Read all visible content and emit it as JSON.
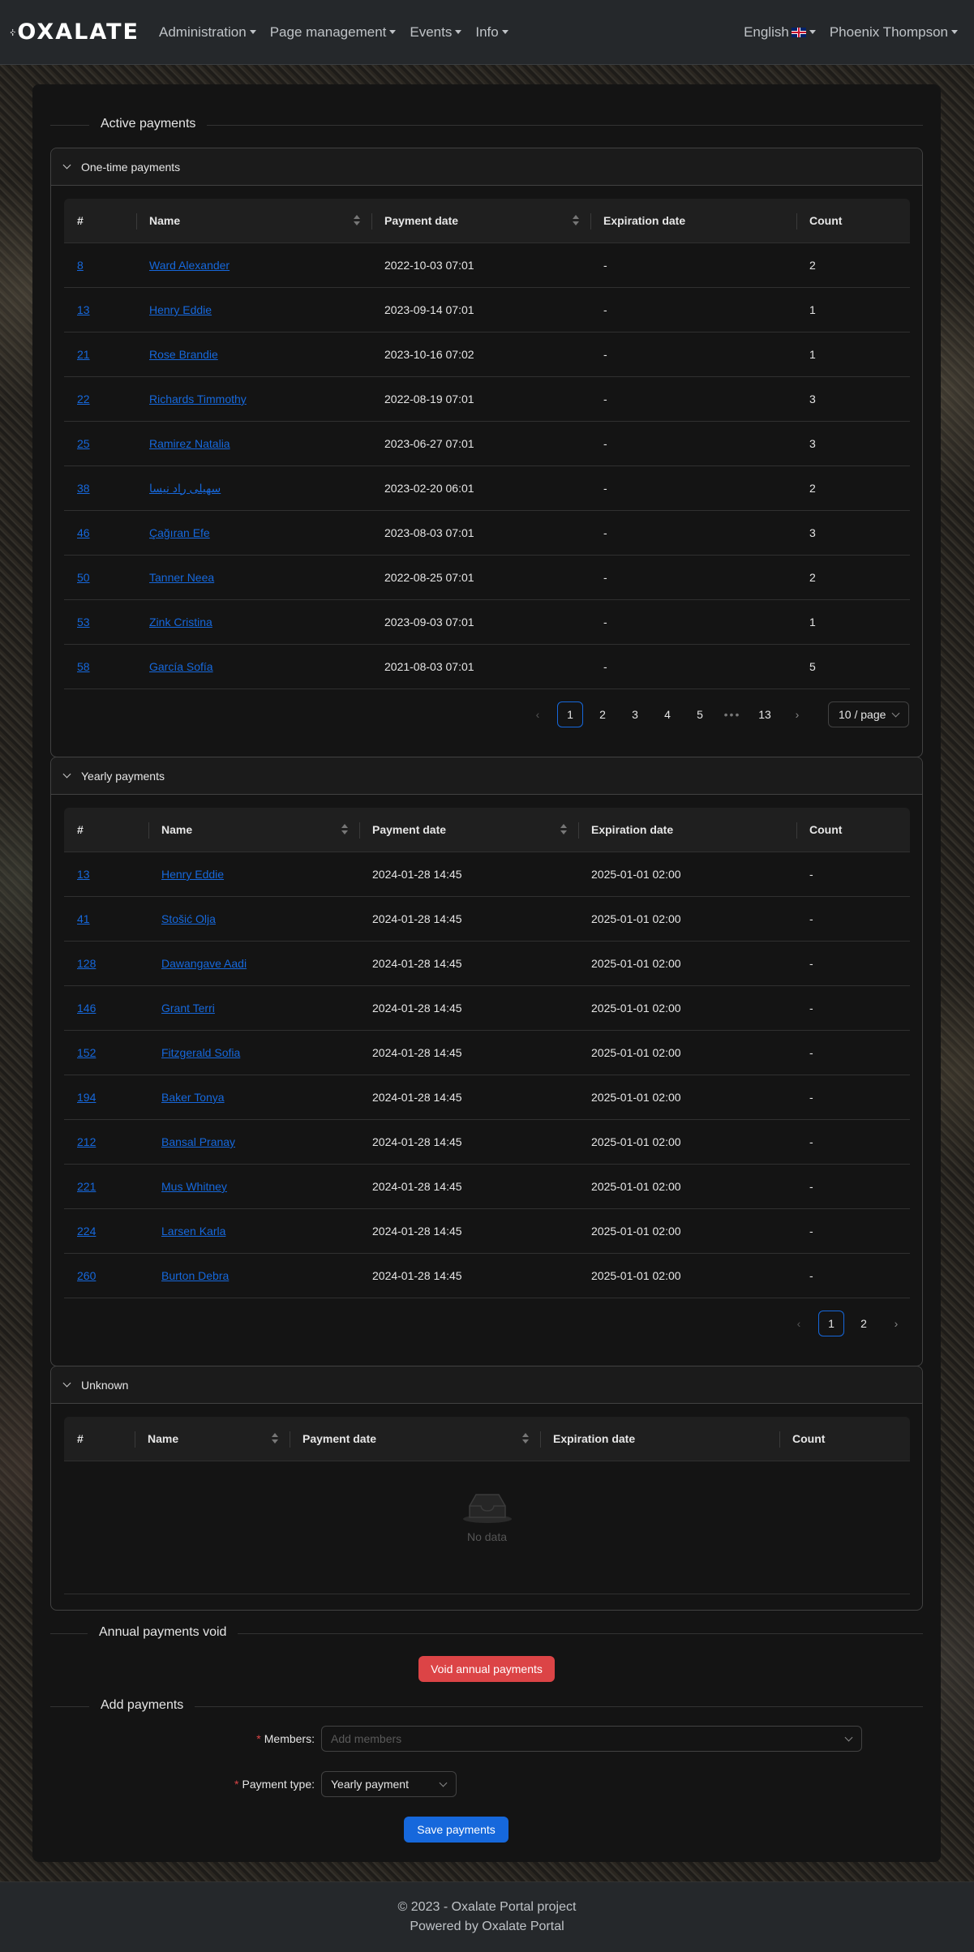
{
  "navbar": {
    "logo_text": "OXALATE",
    "menu": [
      {
        "label": "Administration"
      },
      {
        "label": "Page management"
      },
      {
        "label": "Events"
      },
      {
        "label": "Info"
      }
    ],
    "language": "English",
    "user": "Phoenix Thompson"
  },
  "active_payments": {
    "title": "Active payments",
    "columns": [
      "#",
      "Name",
      "Payment date",
      "Expiration date",
      "Count"
    ],
    "one_time": {
      "title": "One-time payments",
      "rows": [
        {
          "id": "8",
          "name": "Ward Alexander",
          "payment_date": "2022-10-03 07:01",
          "expiration": "-",
          "count": "2"
        },
        {
          "id": "13",
          "name": "Henry Eddie",
          "payment_date": "2023-09-14 07:01",
          "expiration": "-",
          "count": "1"
        },
        {
          "id": "21",
          "name": "Rose Brandie",
          "payment_date": "2023-10-16 07:02",
          "expiration": "-",
          "count": "1"
        },
        {
          "id": "22",
          "name": "Richards Timmothy",
          "payment_date": "2022-08-19 07:01",
          "expiration": "-",
          "count": "3"
        },
        {
          "id": "25",
          "name": "Ramirez Natalia",
          "payment_date": "2023-06-27 07:01",
          "expiration": "-",
          "count": "3"
        },
        {
          "id": "38",
          "name": "سهیلی راد نیسا",
          "payment_date": "2023-02-20 06:01",
          "expiration": "-",
          "count": "2"
        },
        {
          "id": "46",
          "name": "Çağıran Efe",
          "payment_date": "2023-08-03 07:01",
          "expiration": "-",
          "count": "3"
        },
        {
          "id": "50",
          "name": "Tanner Neea",
          "payment_date": "2022-08-25 07:01",
          "expiration": "-",
          "count": "2"
        },
        {
          "id": "53",
          "name": "Zink Cristina",
          "payment_date": "2023-09-03 07:01",
          "expiration": "-",
          "count": "1"
        },
        {
          "id": "58",
          "name": "García Sofía",
          "payment_date": "2021-08-03 07:01",
          "expiration": "-",
          "count": "5"
        }
      ],
      "pagination": {
        "pages": [
          "1",
          "2",
          "3",
          "4",
          "5"
        ],
        "ellipsis": "•••",
        "last": "13",
        "page_size": "10 / page"
      }
    },
    "yearly": {
      "title": "Yearly payments",
      "rows": [
        {
          "id": "13",
          "name": "Henry Eddie",
          "payment_date": "2024-01-28 14:45",
          "expiration": "2025-01-01 02:00",
          "count": "-"
        },
        {
          "id": "41",
          "name": "Stošić Olja",
          "payment_date": "2024-01-28 14:45",
          "expiration": "2025-01-01 02:00",
          "count": "-"
        },
        {
          "id": "128",
          "name": "Dawangave Aadi",
          "payment_date": "2024-01-28 14:45",
          "expiration": "2025-01-01 02:00",
          "count": "-"
        },
        {
          "id": "146",
          "name": "Grant Terri",
          "payment_date": "2024-01-28 14:45",
          "expiration": "2025-01-01 02:00",
          "count": "-"
        },
        {
          "id": "152",
          "name": "Fitzgerald Sofia",
          "payment_date": "2024-01-28 14:45",
          "expiration": "2025-01-01 02:00",
          "count": "-"
        },
        {
          "id": "194",
          "name": "Baker Tonya",
          "payment_date": "2024-01-28 14:45",
          "expiration": "2025-01-01 02:00",
          "count": "-"
        },
        {
          "id": "212",
          "name": "Bansal Pranay",
          "payment_date": "2024-01-28 14:45",
          "expiration": "2025-01-01 02:00",
          "count": "-"
        },
        {
          "id": "221",
          "name": "Mus Whitney",
          "payment_date": "2024-01-28 14:45",
          "expiration": "2025-01-01 02:00",
          "count": "-"
        },
        {
          "id": "224",
          "name": "Larsen Karla",
          "payment_date": "2024-01-28 14:45",
          "expiration": "2025-01-01 02:00",
          "count": "-"
        },
        {
          "id": "260",
          "name": "Burton Debra",
          "payment_date": "2024-01-28 14:45",
          "expiration": "2025-01-01 02:00",
          "count": "-"
        }
      ],
      "pagination": {
        "pages": [
          "1",
          "2"
        ]
      }
    },
    "unknown": {
      "title": "Unknown",
      "empty_text": "No data"
    }
  },
  "annual_void": {
    "title": "Annual payments void",
    "button": "Void annual payments"
  },
  "add_payments": {
    "title": "Add payments",
    "members_label": "Members",
    "members_placeholder": "Add members",
    "type_label": "Payment type",
    "type_value": "Yearly payment",
    "save_button": "Save payments"
  },
  "footer": {
    "line1": "© 2023 - Oxalate Portal project",
    "line2": "Powered by Oxalate Portal"
  },
  "colors": {
    "link": "#1668dc",
    "primary": "#1668dc",
    "danger": "#dc4446",
    "navbar": "#25282b"
  }
}
